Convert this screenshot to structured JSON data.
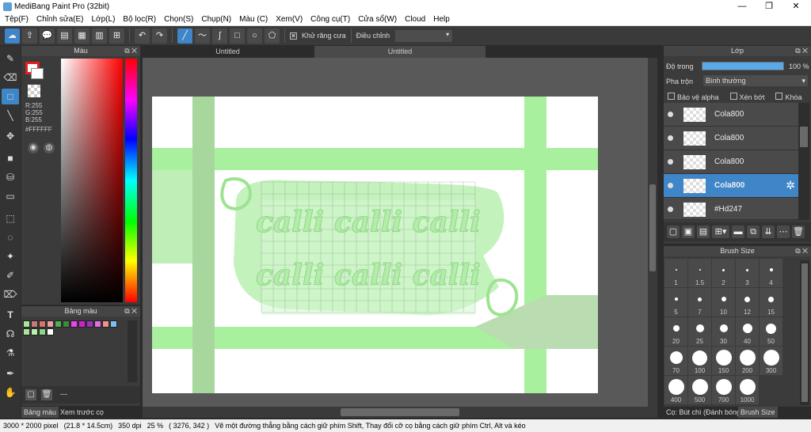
{
  "app": {
    "title": "MediBang Paint Pro (32bit)",
    "window_buttons": [
      "—",
      "❐",
      "✕"
    ]
  },
  "menu": [
    "Tệp(F)",
    "Chỉnh sửa(E)",
    "Lớp(L)",
    "Bộ lọc(R)",
    "Chọn(S)",
    "Chụp(N)",
    "Màu (C)",
    "Xem(V)",
    "Công cụ(T)",
    "Cửa sổ(W)",
    "Cloud",
    "Help"
  ],
  "toolbar": {
    "antialias_label": "Khử răng cưa",
    "adjust_label": "Điều chỉnh"
  },
  "color_panel": {
    "title": "Màu",
    "rgb": [
      "R:255",
      "G:255",
      "B:255"
    ],
    "hex": "#FFFFFF"
  },
  "palette_panel": {
    "title": "Bảng màu",
    "name": "---",
    "colors": [
      "#a8e6a0",
      "#c87a7a",
      "#e07070",
      "#e8a0a0",
      "#4caf50",
      "#3d8b3d",
      "#f040f0",
      "#d020d0",
      "#a030c0",
      "#e070e0",
      "#f09090",
      "#80c0f0",
      "#a8e6a0",
      "#b8f0b0",
      "#88d888",
      "#ffffff"
    ]
  },
  "bottom_tabs": {
    "palette": "Bảng màu",
    "brush_preview": "Xem trước cọ"
  },
  "canvas_tabs": [
    "Untitled",
    "Untitled"
  ],
  "layer_panel": {
    "title": "Lớp",
    "opacity_label": "Độ trong",
    "opacity_value": "100 %",
    "opacity": 1.0,
    "blend_label": "Pha trộn",
    "blend_value": "Bình thường",
    "protect_alpha": "Bảo vệ alpha",
    "clipping": "Xén bớt",
    "lock": "Khóa",
    "layers": [
      {
        "name": "Cola800",
        "selected": false
      },
      {
        "name": "Cola800",
        "selected": false
      },
      {
        "name": "Cola800",
        "selected": false
      },
      {
        "name": "Cola800",
        "selected": true
      },
      {
        "name": "#Hd247",
        "selected": false
      }
    ]
  },
  "brush_panel": {
    "title": "Brush Size",
    "sizes": [
      "1",
      "1.5",
      "2",
      "3",
      "4",
      "5",
      "7",
      "10",
      "12",
      "15",
      "20",
      "25",
      "30",
      "40",
      "50",
      "70",
      "100",
      "150",
      "200",
      "300",
      "400",
      "500",
      "700",
      "1000"
    ]
  },
  "right_bottom_tabs": {
    "brush": "Cọ: Bút chì (Đánh bóng)",
    "brush_size": "Brush Size"
  },
  "artwork": {
    "text": "calli calli calli"
  },
  "status": {
    "size": "3000 * 2000 pixel",
    "cm": "(21.8 * 14.5cm)",
    "dpi": "350 dpi",
    "zoom": "25 %",
    "coords": "( 3276, 342 )",
    "hint": "Vẽ một đường thẳng bằng cách giữ phím Shift, Thay đổi cỡ cọ bằng cách giữ phím Ctrl, Alt và kéo"
  }
}
